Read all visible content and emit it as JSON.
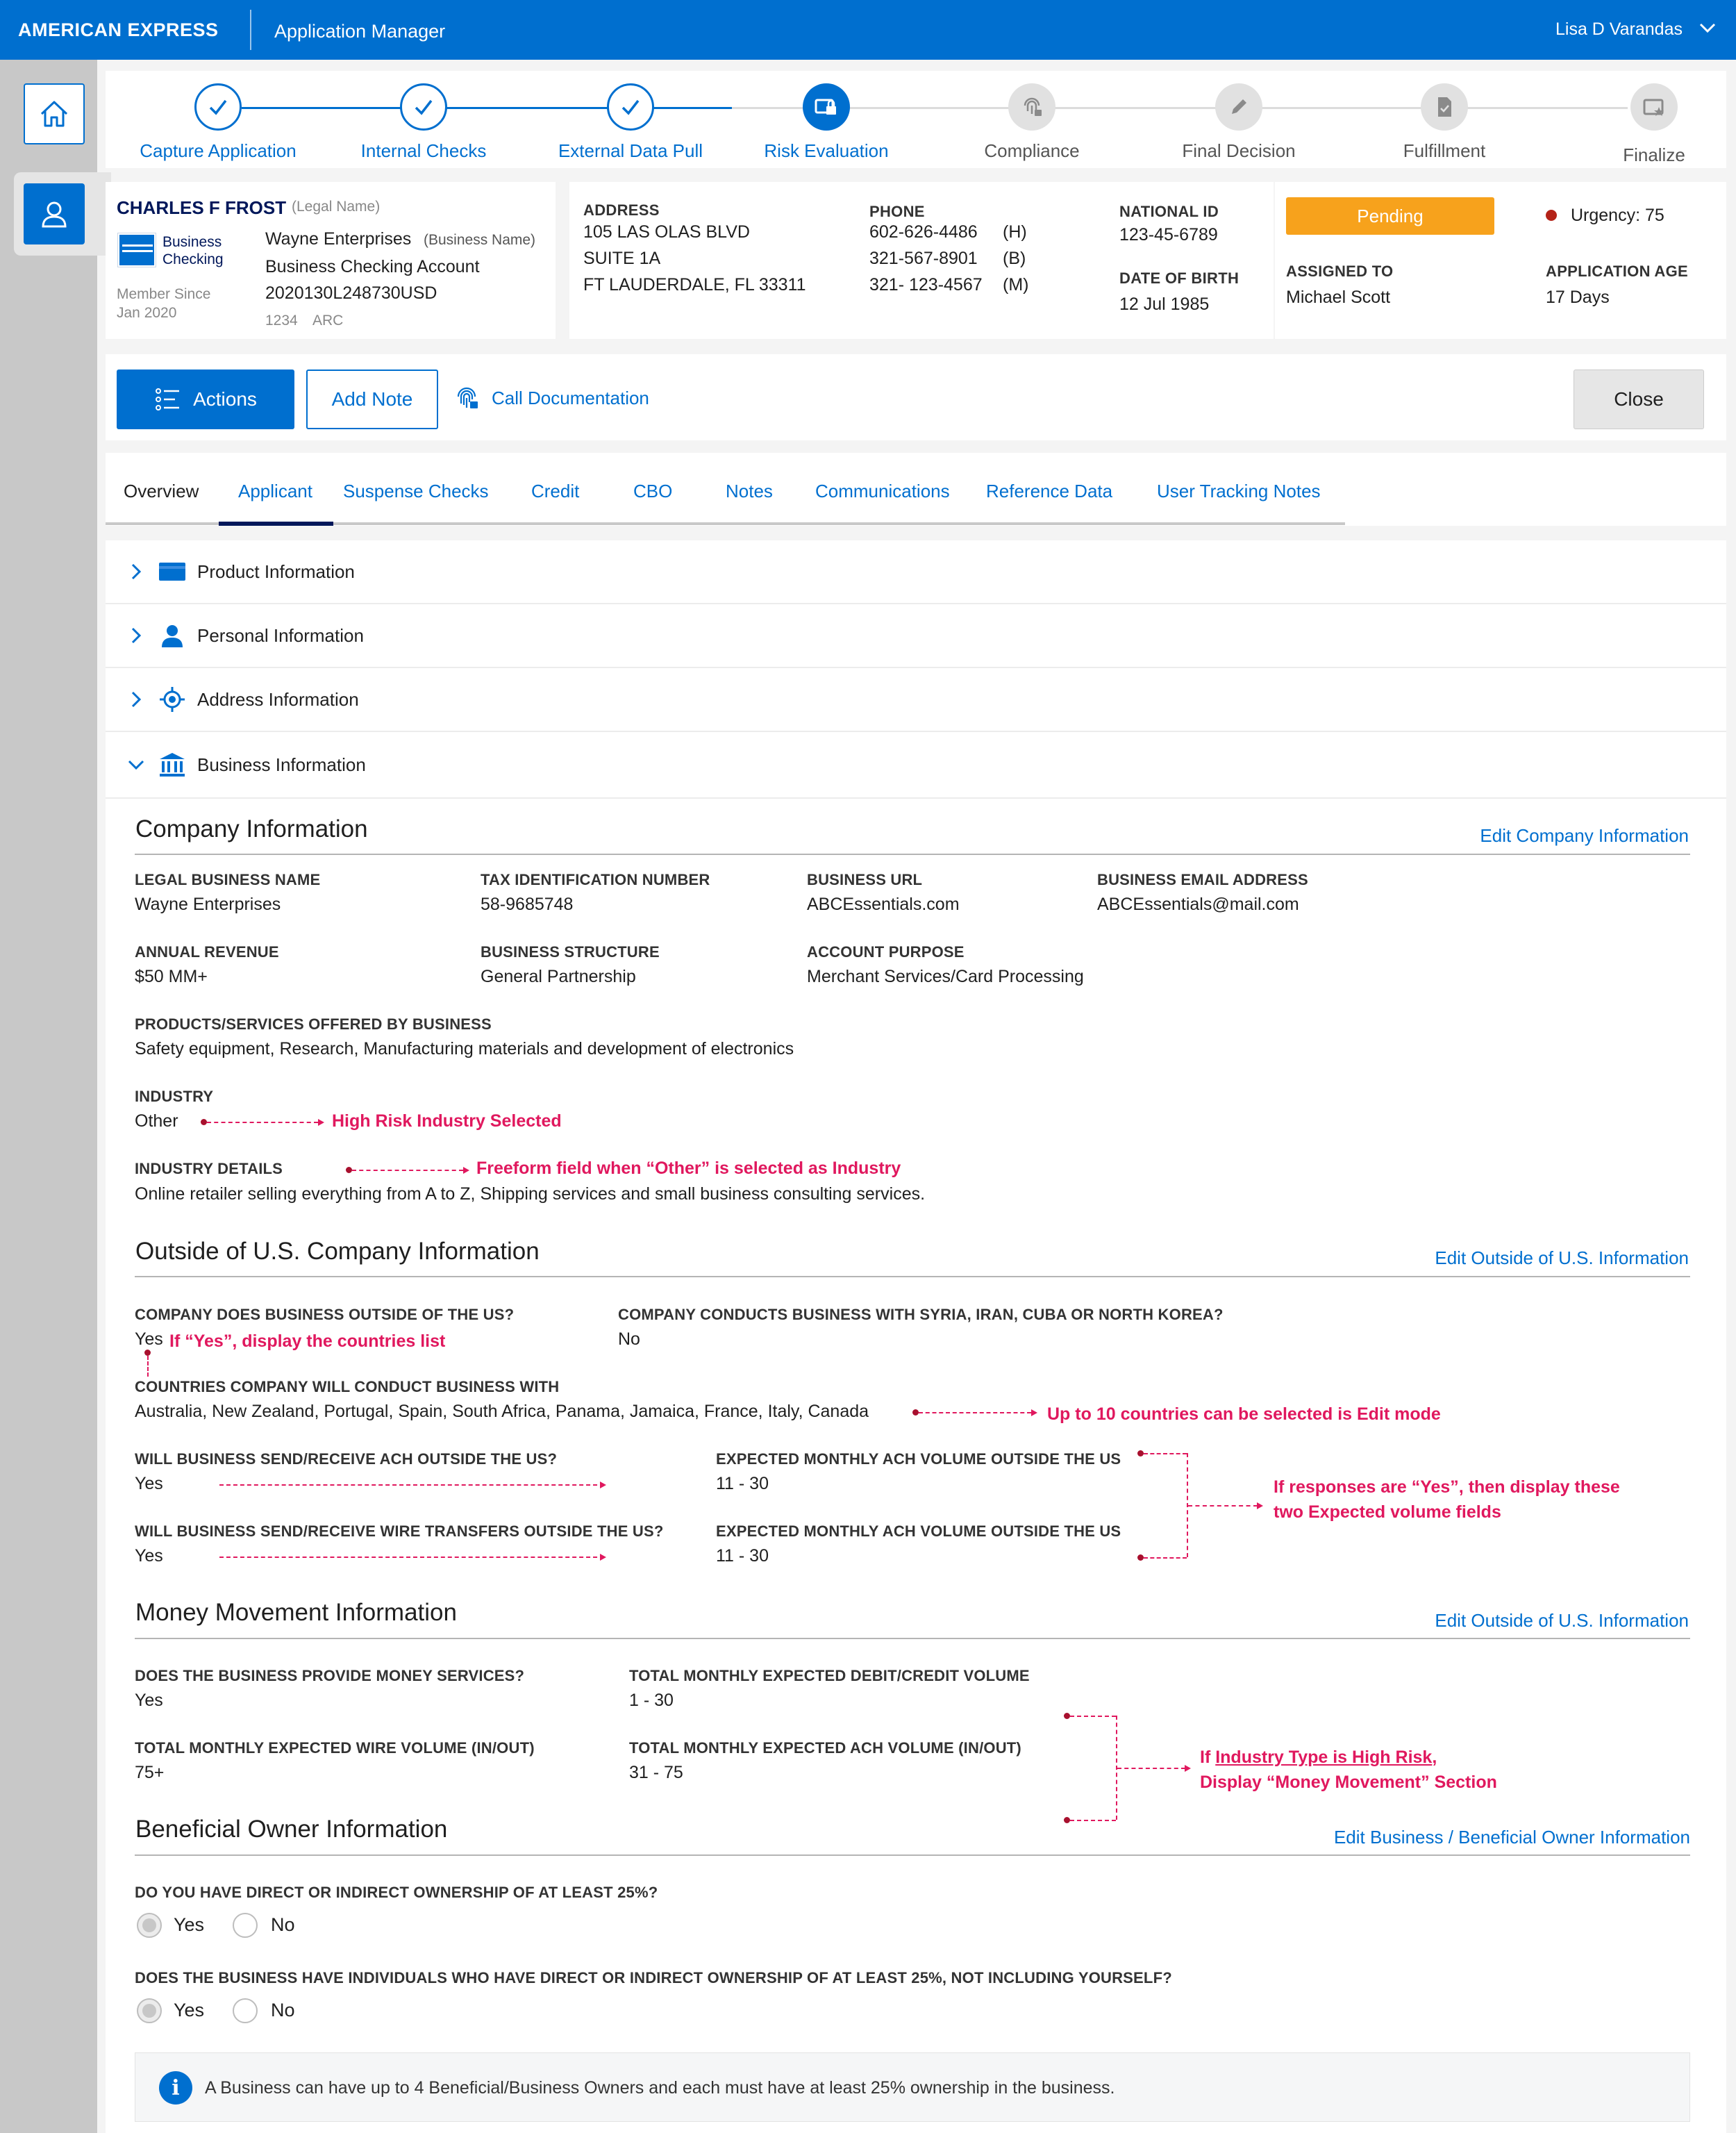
{
  "header": {
    "brand": "AMERICAN EXPRESS",
    "app_name": "Application Manager",
    "user_name": "Lisa D Varandas"
  },
  "stepper": {
    "steps": [
      {
        "label": "Capture Application",
        "state": "done"
      },
      {
        "label": "Internal Checks",
        "state": "done"
      },
      {
        "label": "External Data Pull",
        "state": "done"
      },
      {
        "label": "Risk Evaluation",
        "state": "active"
      },
      {
        "label": "Compliance",
        "state": "todo"
      },
      {
        "label": "Final Decision",
        "state": "todo"
      },
      {
        "label": "Fulfillment",
        "state": "todo"
      },
      {
        "label": "Finalize",
        "state": "todo"
      }
    ]
  },
  "customer": {
    "name": "CHARLES F FROST",
    "name_type": "(Legal Name)",
    "card_label_1": "Business",
    "card_label_2": "Checking",
    "member_since_label": "Member Since",
    "member_since": "Jan 2020",
    "business_name": "Wayne Enterprises",
    "business_name_type": "(Business Name)",
    "account_type": "Business Checking Account",
    "account_number": "2020130L248730USD",
    "code1": "1234",
    "code2": "ARC"
  },
  "address": {
    "label": "ADDRESS",
    "line1": "105 LAS OLAS BLVD",
    "line2": "SUITE 1A",
    "line3": "FT LAUDERDALE, FL 33311"
  },
  "phone": {
    "label": "PHONE",
    "numbers": [
      {
        "number": "602-626-4486",
        "type": "(H)"
      },
      {
        "number": "321-567-8901",
        "type": "(B)"
      },
      {
        "number": "321- 123-4567",
        "type": "(M)"
      }
    ]
  },
  "national_id": {
    "label": "NATIONAL ID",
    "value": "123-45-6789"
  },
  "dob": {
    "label": "DATE OF BIRTH",
    "value": "12 Jul 1985"
  },
  "status": {
    "badge": "Pending",
    "badge_color": "#f7a21c",
    "urgency": "Urgency: 75",
    "urgency_color": "#b42318",
    "assigned_label": "ASSIGNED TO",
    "assigned_value": "Michael Scott",
    "age_label": "APPLICATION AGE",
    "age_value": "17 Days"
  },
  "actionbar": {
    "actions": "Actions",
    "add_note": "Add Note",
    "call_doc": "Call Documentation",
    "close": "Close"
  },
  "tabs": [
    {
      "label": "Overview",
      "active": false
    },
    {
      "label": "Applicant",
      "active": true
    },
    {
      "label": "Suspense Checks",
      "active": false
    },
    {
      "label": "Credit",
      "active": false
    },
    {
      "label": "CBO",
      "active": false
    },
    {
      "label": "Notes",
      "active": false
    },
    {
      "label": "Communications",
      "active": false
    },
    {
      "label": "Reference Data",
      "active": false
    },
    {
      "label": "User Tracking Notes",
      "active": false
    }
  ],
  "accordion": [
    {
      "label": "Product Information",
      "icon": "card-icon",
      "expanded": false
    },
    {
      "label": "Personal Information",
      "icon": "person-icon",
      "expanded": false
    },
    {
      "label": "Address Information",
      "icon": "location-target-icon",
      "expanded": false
    },
    {
      "label": "Business Information",
      "icon": "bank-icon",
      "expanded": true
    }
  ],
  "company": {
    "title": "Company Information",
    "edit": "Edit Company Information",
    "legal_name_label": "LEGAL BUSINESS NAME",
    "legal_name": "Wayne Enterprises",
    "tin_label": "TAX IDENTIFICATION NUMBER",
    "tin": "58-9685748",
    "url_label": "BUSINESS URL",
    "url": "ABCEssentials.com",
    "email_label": "BUSINESS EMAIL ADDRESS",
    "email": "ABCEssentials@mail.com",
    "revenue_label": "ANNUAL REVENUE",
    "revenue": "$50 MM+",
    "structure_label": "BUSINESS STRUCTURE",
    "structure": "General Partnership",
    "purpose_label": "ACCOUNT PURPOSE",
    "purpose": "Merchant Services/Card Processing",
    "products_label": "PRODUCTS/SERVICES OFFERED BY BUSINESS",
    "products": "Safety equipment, Research, Manufacturing materials and development of electronics",
    "industry_label": "INDUSTRY",
    "industry": "Other",
    "industry_details_label": "INDUSTRY DETAILS",
    "industry_details": "Online retailer selling everything from A to Z, Shipping services and small business consulting services."
  },
  "outside": {
    "title": "Outside of U.S. Company Information",
    "edit": "Edit Outside of U.S. Information",
    "outside_label": "COMPANY DOES BUSINESS OUTSIDE OF THE US?",
    "outside_value": "Yes",
    "sanctioned_label": "COMPANY CONDUCTS BUSINESS WITH SYRIA, IRAN, CUBA OR NORTH KOREA?",
    "sanctioned_value": "No",
    "countries_label": "COUNTRIES COMPANY WILL CONDUCT BUSINESS WITH",
    "countries": "Australia, New Zealand, Portugal, Spain, South Africa, Panama, Jamaica, France, Italy, Canada",
    "ach_label": "WILL BUSINESS SEND/RECEIVE ACH OUTSIDE THE US?",
    "ach_value": "Yes",
    "ach_vol_label": "EXPECTED MONTHLY ACH VOLUME OUTSIDE THE US",
    "ach_vol_value": "11 - 30",
    "wire_label": "WILL BUSINESS SEND/RECEIVE WIRE TRANSFERS OUTSIDE THE US?",
    "wire_value": "Yes",
    "wire_vol_label": "EXPECTED MONTHLY ACH VOLUME OUTSIDE THE US",
    "wire_vol_value": "11 - 30"
  },
  "money": {
    "title": "Money Movement Information",
    "edit": "Edit Outside of U.S. Information",
    "services_label": "DOES THE BUSINESS PROVIDE MONEY SERVICES?",
    "services_value": "Yes",
    "debit_label": "TOTAL MONTHLY EXPECTED DEBIT/CREDIT VOLUME",
    "debit_value": "1 - 30",
    "wire_label": "TOTAL MONTHLY EXPECTED WIRE VOLUME (IN/OUT)",
    "wire_value": "75+",
    "ach_label": "TOTAL MONTHLY EXPECTED ACH VOLUME (IN/OUT)",
    "ach_value": "31 - 75"
  },
  "owner": {
    "title": "Beneficial Owner Information",
    "edit": "Edit Business / Beneficial Owner Information",
    "q1": "DO YOU HAVE DIRECT OR INDIRECT OWNERSHIP OF AT LEAST 25%?",
    "q2": "DOES THE BUSINESS HAVE INDIVIDUALS WHO HAVE DIRECT OR INDIRECT OWNERSHIP OF AT LEAST 25%, NOT INCLUDING YOURSELF?",
    "yes": "Yes",
    "no": "No",
    "info": "A Business can have up to 4 Beneficial/Business Owners and each must have at least 25% ownership in the business."
  },
  "annotations": {
    "industry": "High Risk Industry Selected",
    "industry_details": "Freeform field when “Other” is selected as Industry",
    "yes_countries": "If “Yes”, display the countries list",
    "countries_limit": "Up to 10 countries can be selected is Edit mode",
    "volume_line1": "If responses are “Yes”, then display these",
    "volume_line2": "two Expected volume fields",
    "money_line1_prefix": "If ",
    "money_line1_link": "Industry Type is High Risk",
    "money_line1_suffix": ",",
    "money_line2": "Display “Money Movement” Section",
    "color": "#e0185e"
  }
}
